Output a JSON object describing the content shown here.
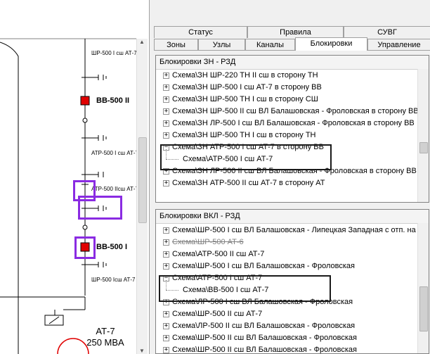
{
  "schematic": {
    "labels": {
      "top_bus": "ШР-500 I сш АТ-7",
      "breaker_top": "ВВ-500 II",
      "atr": "АТР-500 I сш АТ-7",
      "apr": "АТР-500 IIсш АТ-7",
      "breaker_bottom": "ВВ-500 I",
      "bottom_bus": "ШР-500 Iсш АТ-7",
      "transformer_name": "АТ-7",
      "transformer_power": "250 MBA"
    },
    "colors": {
      "breaker": "#e00000",
      "highlight": "#8a2be2"
    }
  },
  "tabs": {
    "row1": [
      "Статус",
      "Правила",
      "СУВГ"
    ],
    "row2": [
      "Зоны",
      "Узлы",
      "Каналы",
      "Блокировки",
      "Управление"
    ],
    "active": "Блокировки"
  },
  "zn_pane": {
    "title": "Блокировки ЗН - РЗД",
    "items": [
      {
        "text": "Схема\\ЗН ШР-220 ТН II сш в сторону ТН",
        "expander": "+"
      },
      {
        "text": "Схема\\ЗН ШР-500 I сш АТ-7 в сторону ВВ",
        "expander": "+"
      },
      {
        "text": "Схема\\ЗН ШР-500 ТН I сш в сторону СШ",
        "expander": "+"
      },
      {
        "text": "Схема\\ЗН ШР-500 II сш ВЛ Балашовская - Фроловская в сторону ВВ",
        "expander": "+"
      },
      {
        "text": "Схема\\ЗН ЛР-500 I сш ВЛ Балашовская - Фроловская в сторону ВВ",
        "expander": "+"
      },
      {
        "text": "Схема\\ЗН ШР-500 ТН I сш в сторону ТН",
        "expander": "+"
      },
      {
        "text": "Схема\\ЗН АТР-500 I сш АТ-7 в сторону ВВ",
        "expander": "−"
      },
      {
        "text": "Схема\\АТР-500 I сш АТ-7",
        "expander": "",
        "child": true
      },
      {
        "text": "Схема\\ЗН ЛР-500 II сш ВЛ Балашовская - Фроловская в сторону ВВ",
        "expander": "+"
      },
      {
        "text": "Схема\\ЗН АТР-500 II сш АТ-7 в сторону АТ",
        "expander": "+"
      }
    ]
  },
  "vkl_pane": {
    "title": "Блокировки ВКЛ - РЗД",
    "items": [
      {
        "text": "Схема\\ШР-500 I сш ВЛ Балашовская - Липецкая Западная с отп. на Т",
        "expander": "+"
      },
      {
        "text": "Схема\\ШР-500 АТ-6",
        "expander": "+",
        "gray": true
      },
      {
        "text": "Схема\\АТР-500 II сш АТ-7",
        "expander": "+"
      },
      {
        "text": "Схема\\ШР-500 I сш ВЛ Балашовская - Фроловская",
        "expander": "+"
      },
      {
        "text": "Схема\\АТР-500 I сш АТ-7",
        "expander": "−"
      },
      {
        "text": "Схема\\ВВ-500 I сш АТ-7",
        "expander": "",
        "child": true
      },
      {
        "text": "Схема\\ЛР-500 I сш ВЛ Балашовская - Фроловская",
        "expander": "+"
      },
      {
        "text": "Схема\\ШР-500 II сш АТ-7",
        "expander": "+"
      },
      {
        "text": "Схема\\ЛР-500 II сш ВЛ Балашовская - Фроловская",
        "expander": "+"
      },
      {
        "text": "Схема\\ШР-500 II сш ВЛ Балашовская - Фроловская",
        "expander": "+"
      },
      {
        "text": "Схема\\ШР-500 II сш ВЛ Балашовская - Фроловская",
        "expander": "+"
      }
    ]
  }
}
